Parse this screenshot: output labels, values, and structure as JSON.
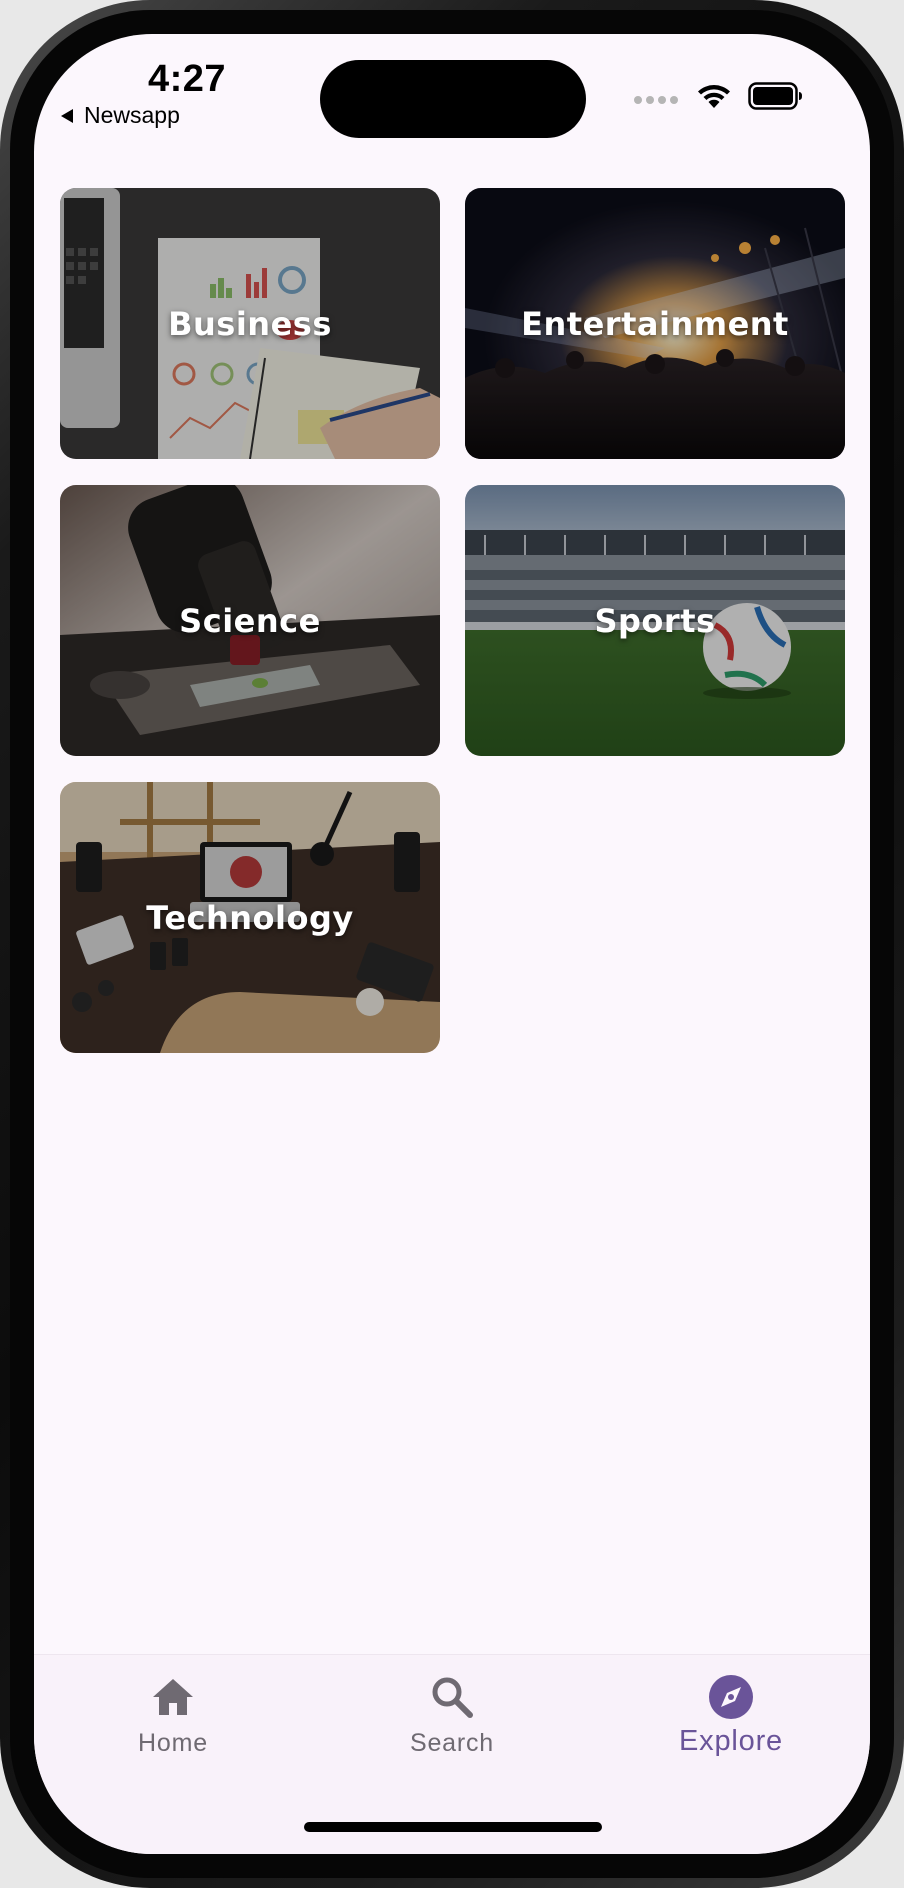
{
  "status_bar": {
    "time": "4:27",
    "back_app": "Newsapp"
  },
  "categories": [
    {
      "label": "Business"
    },
    {
      "label": "Entertainment"
    },
    {
      "label": "Science"
    },
    {
      "label": "Sports"
    },
    {
      "label": "Technology"
    }
  ],
  "bottom_nav": {
    "items": [
      {
        "label": "Home",
        "icon": "home-icon"
      },
      {
        "label": "Search",
        "icon": "search-icon"
      },
      {
        "label": "Explore",
        "icon": "compass-icon"
      }
    ],
    "active": "Explore"
  },
  "colors": {
    "background": "#fcf7fd",
    "nav_active": "#6a5499",
    "nav_inactive": "#6f6a72"
  }
}
